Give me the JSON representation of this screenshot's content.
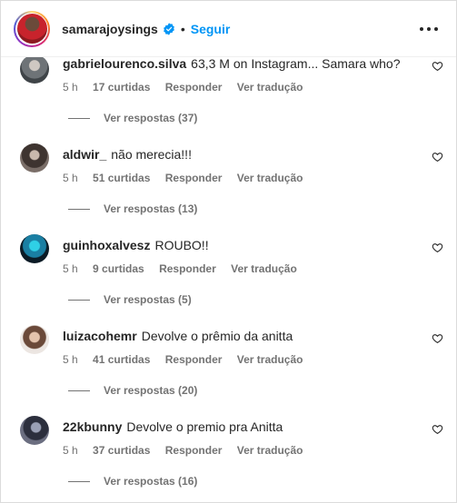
{
  "header": {
    "username": "samarajoysings",
    "separator": "•",
    "follow_label": "Seguir"
  },
  "comments": [
    {
      "user": "gabrielourenco.silva",
      "text": "63,3 M on Instagram... Samara who?",
      "time": "5 h",
      "likes": "17 curtidas",
      "reply": "Responder",
      "translate": "Ver tradução",
      "replies": "Ver respostas (37)",
      "avatar_color": "#8a8f93"
    },
    {
      "user": "aldwir_",
      "text": "não merecia!!!",
      "time": "5 h",
      "likes": "51 curtidas",
      "reply": "Responder",
      "translate": "Ver tradução",
      "replies": "Ver respostas (13)",
      "avatar_color": "#5a4e4a"
    },
    {
      "user": "guinhoxalvesz",
      "text": "ROUBO!!",
      "time": "5 h",
      "likes": "9 curtidas",
      "reply": "Responder",
      "translate": "Ver tradução",
      "replies": "Ver respostas (5)",
      "avatar_color": "#1d5f8a"
    },
    {
      "user": "luizacohemr",
      "text": "Devolve o prêmio da anitta",
      "time": "5 h",
      "likes": "41 curtidas",
      "reply": "Responder",
      "translate": "Ver tradução",
      "replies": "Ver respostas (20)",
      "avatar_color": "#b8977f"
    },
    {
      "user": "22kbunny",
      "text": "Devolve o premio pra Anitta",
      "time": "5 h",
      "likes": "37 curtidas",
      "reply": "Responder",
      "translate": "Ver tradução",
      "replies": "Ver respostas (16)",
      "avatar_color": "#4b4f63"
    }
  ],
  "colors": {
    "accent": "#0095f6",
    "verified": "#0095f6",
    "secondary_text": "#737373"
  }
}
